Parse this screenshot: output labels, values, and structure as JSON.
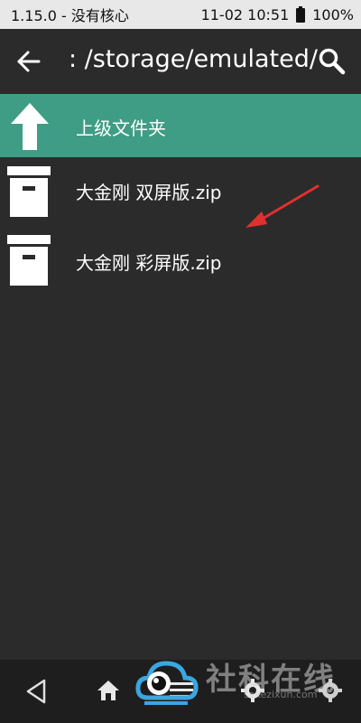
{
  "status_bar": {
    "left_text": "1.15.0 - 没有核心",
    "datetime": "11-02 10:51",
    "battery": "100%"
  },
  "header": {
    "path": ": /storage/emulated/",
    "back_icon": "arrow-left-icon",
    "search_icon": "search-icon"
  },
  "list": {
    "parent_folder": "上级文件夹",
    "items": [
      {
        "name": "大金刚 双屏版.zip",
        "icon": "archive-box-icon"
      },
      {
        "name": "大金刚 彩屏版.zip",
        "icon": "archive-box-icon"
      }
    ]
  },
  "nav_bar": {
    "buttons": [
      "back-triangle-icon",
      "home-icon",
      "menu-icon",
      "settings-icon"
    ]
  },
  "watermark": {
    "brand_text": "社科在线",
    "sub_text": "sakezixun.com"
  },
  "colors": {
    "background": "#2b2b2b",
    "status_bar": "#e8e8e8",
    "accent_row": "#3e9d84",
    "annotation_arrow": "#e03030"
  }
}
